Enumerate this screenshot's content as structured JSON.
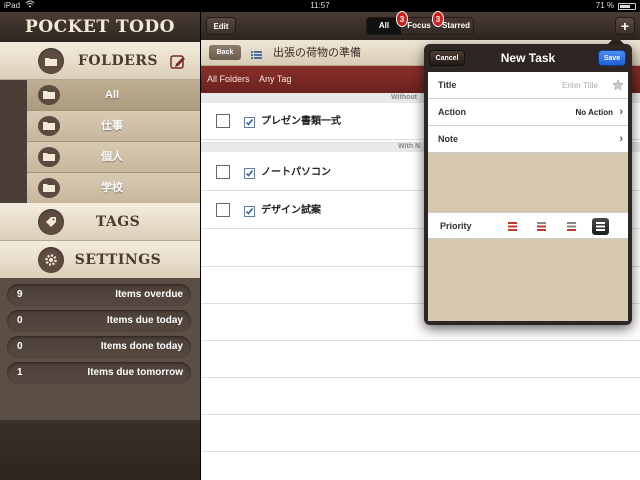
{
  "status": {
    "device": "iPad",
    "time": "11:57",
    "battery": "71 %",
    "battery_level": 0.71
  },
  "sidebar": {
    "logo": "POCKET TODO",
    "folders_label": "FOLDERS",
    "folder_items": [
      {
        "label": "All",
        "selected": true
      },
      {
        "label": "仕事",
        "selected": false
      },
      {
        "label": "個人",
        "selected": false
      },
      {
        "label": "学校",
        "selected": false
      }
    ],
    "tags_label": "TAGS",
    "settings_label": "SETTINGS",
    "summary": [
      {
        "count": "9",
        "label": "Items overdue"
      },
      {
        "count": "0",
        "label": "Items due today"
      },
      {
        "count": "0",
        "label": "Items done today"
      },
      {
        "count": "1",
        "label": "Items due tomorrow"
      }
    ]
  },
  "toolbar": {
    "edit_label": "Edit",
    "filters": [
      {
        "label": "All",
        "badge": ""
      },
      {
        "label": "Focus",
        "badge": "3"
      },
      {
        "label": "Starred",
        "badge": "3"
      }
    ],
    "add_label": "+"
  },
  "subbar": {
    "back_label": "Back",
    "title": "出張の荷物の準備"
  },
  "filterbar": {
    "folder": "All Folders",
    "tag": "Any Tag"
  },
  "groups": [
    {
      "label": "Without"
    },
    {
      "label": "With N"
    }
  ],
  "tasks": [
    {
      "title": "プレゼン書類一式"
    },
    {
      "title": "ノートパソコン"
    },
    {
      "title": "デザイン試案"
    }
  ],
  "new_task": {
    "title": "New Task",
    "cancel_label": "Cancel",
    "save_label": "Save",
    "title_label": "Title",
    "title_placeholder": "Enter Title",
    "action_label": "Action",
    "action_value": "No Action",
    "note_label": "Note",
    "priority_label": "Priority",
    "priority_selected": 3
  },
  "colors": {
    "accent_red": "#8a2f2a",
    "sidebar_dark": "#5b4f45",
    "save_blue": "#2e6ee6"
  }
}
